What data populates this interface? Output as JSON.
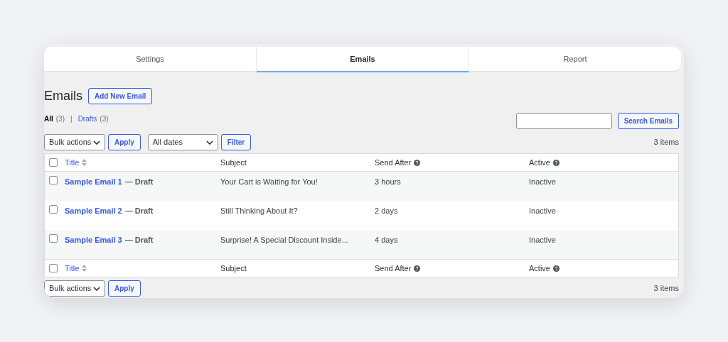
{
  "tabs": [
    {
      "label": "Settings",
      "selected": false
    },
    {
      "label": "Emails",
      "selected": true
    },
    {
      "label": "Report",
      "selected": false
    }
  ],
  "heading": "Emails",
  "add_button": "Add New Email",
  "views": [
    {
      "label": "All",
      "count": "(3)",
      "selected": true
    },
    {
      "label": "Drafts",
      "count": "(3)",
      "selected": false
    }
  ],
  "views_separator": "|",
  "search": {
    "button": "Search Emails"
  },
  "top_toolbar": {
    "bulk_select": "Bulk actions",
    "apply": "Apply",
    "date_select": "All dates",
    "filter": "Filter",
    "count": "3 items"
  },
  "table": {
    "header_select_all_checked": false,
    "footer_select_all_checked": false,
    "header_columns": [
      {
        "label": "Title",
        "kind": "sortable"
      },
      {
        "label": "Subject",
        "kind": "plain"
      },
      {
        "label": "Send After",
        "kind": "help"
      },
      {
        "label": "Active",
        "kind": "help"
      }
    ],
    "rows": [
      {
        "checked": false,
        "title": "Sample Email 1",
        "state": "— Draft",
        "subject": "Your Cart is Waiting for You!",
        "send_after": "3 hours",
        "active": "Inactive"
      },
      {
        "checked": false,
        "title": "Sample Email 2",
        "state": "— Draft",
        "subject": "Still Thinking About It?",
        "send_after": "2 days",
        "active": "Inactive"
      },
      {
        "checked": false,
        "title": "Sample Email 3",
        "state": "— Draft",
        "subject": "Surprise! A Special Discount Inside...",
        "send_after": "4 days",
        "active": "Inactive"
      }
    ],
    "footer_columns": [
      {
        "label": "Title",
        "kind": "sortable"
      },
      {
        "label": "Subject",
        "kind": "plain"
      },
      {
        "label": "Send After",
        "kind": "help"
      },
      {
        "label": "Active",
        "kind": "help"
      }
    ]
  },
  "bottom_toolbar": {
    "bulk_select": "Bulk actions",
    "apply": "Apply",
    "count": "3 items"
  }
}
